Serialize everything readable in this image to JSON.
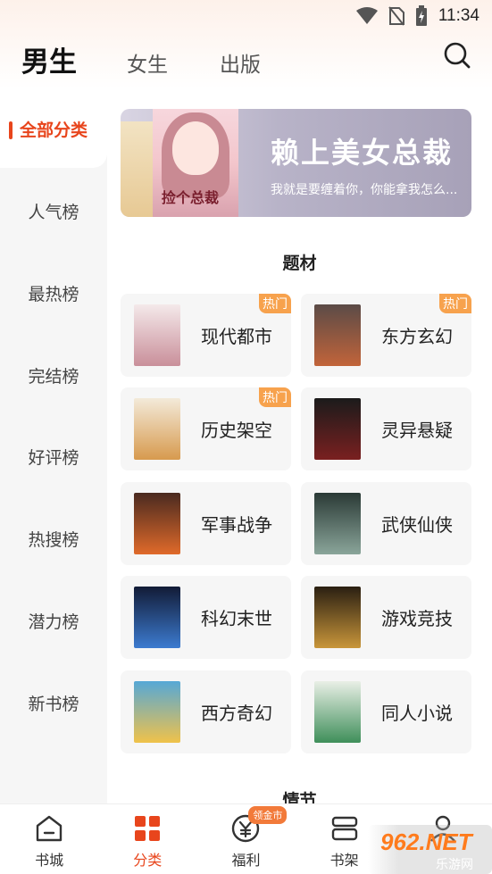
{
  "status_bar": {
    "time": "11:34"
  },
  "header": {
    "tabs": [
      {
        "label": "男生",
        "active": true
      },
      {
        "label": "女生",
        "active": false
      },
      {
        "label": "出版",
        "active": false
      }
    ],
    "search_icon": "search-icon"
  },
  "sidebar": {
    "items": [
      {
        "label": "全部分类",
        "active": true
      },
      {
        "label": "人气榜"
      },
      {
        "label": "最热榜"
      },
      {
        "label": "完结榜"
      },
      {
        "label": "好评榜"
      },
      {
        "label": "热搜榜"
      },
      {
        "label": "潜力榜"
      },
      {
        "label": "新书榜"
      }
    ]
  },
  "banner": {
    "title": "赖上美女总裁",
    "description": "我就是要缠着你，你能拿我怎么...",
    "cover_title": "捡个总裁"
  },
  "sections": {
    "topic_title": "题材",
    "plot_title": "情节"
  },
  "categories": [
    {
      "label": "现代都市",
      "hot": "热门",
      "colors": [
        "#f4e9ea",
        "#c98f9a"
      ]
    },
    {
      "label": "东方玄幻",
      "hot": "热门",
      "colors": [
        "#5b4b47",
        "#c2643a"
      ]
    },
    {
      "label": "历史架空",
      "hot": "热门",
      "colors": [
        "#f3ead9",
        "#d79a4e"
      ]
    },
    {
      "label": "灵异悬疑",
      "hot": "",
      "colors": [
        "#1b1b1b",
        "#7a2020"
      ]
    },
    {
      "label": "军事战争",
      "hot": "",
      "colors": [
        "#4a2a20",
        "#e06a2a"
      ]
    },
    {
      "label": "武侠仙侠",
      "hot": "",
      "colors": [
        "#2b3a36",
        "#8aa59a"
      ]
    },
    {
      "label": "科幻末世",
      "hot": "",
      "colors": [
        "#121b36",
        "#3c7bd0"
      ]
    },
    {
      "label": "游戏竞技",
      "hot": "",
      "colors": [
        "#2a1f12",
        "#c9963a"
      ]
    },
    {
      "label": "西方奇幻",
      "hot": "",
      "colors": [
        "#56a8d6",
        "#f0c24a"
      ]
    },
    {
      "label": "同人小说",
      "hot": "",
      "colors": [
        "#e9efe6",
        "#3f8f5a"
      ]
    }
  ],
  "bottom_nav": [
    {
      "label": "书城",
      "icon": "home-icon"
    },
    {
      "label": "分类",
      "icon": "category-icon",
      "active": true
    },
    {
      "label": "福利",
      "icon": "yen-coin-icon",
      "badge": "领金市"
    },
    {
      "label": "书架",
      "icon": "bookshelf-icon"
    },
    {
      "label": "",
      "icon": "profile-icon"
    }
  ],
  "watermark": {
    "text": "962.NET",
    "sub": "乐游网"
  },
  "colors": {
    "accent": "#e8451c",
    "hot_badge": "#f7a24d",
    "card_bg": "#f6f6f6"
  }
}
